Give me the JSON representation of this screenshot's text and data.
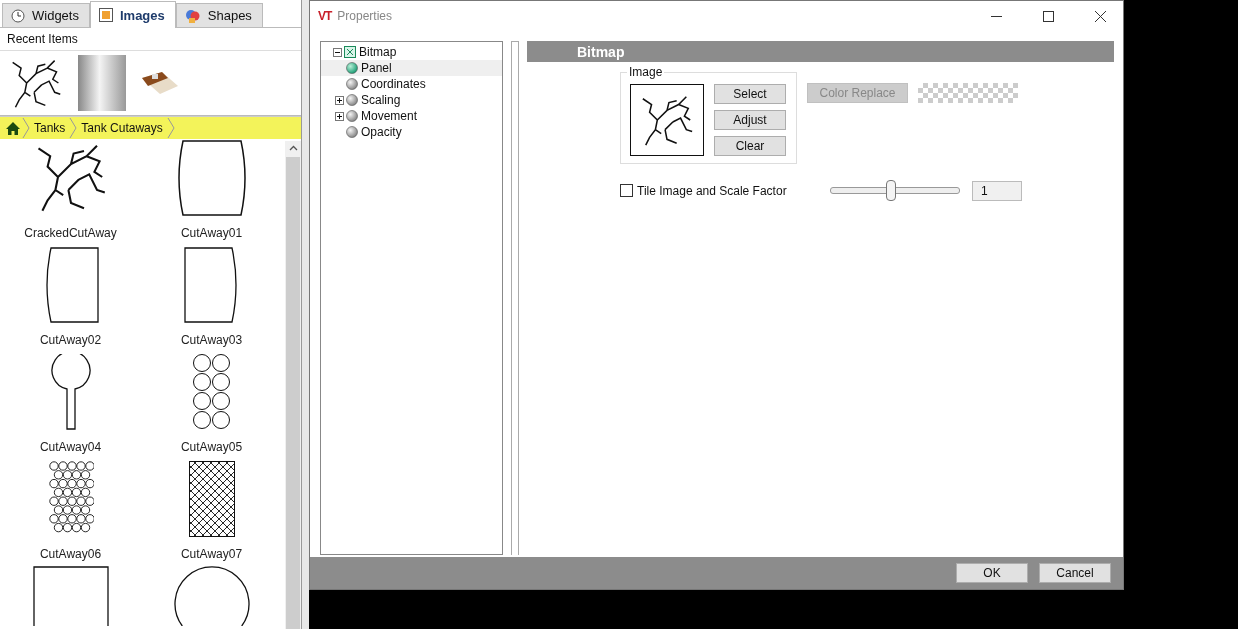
{
  "library": {
    "tabs": [
      {
        "label": "Widgets",
        "selected": false
      },
      {
        "label": "Images",
        "selected": true
      },
      {
        "label": "Shapes",
        "selected": false
      }
    ],
    "recent_title": "Recent Items",
    "recent_items": [
      {
        "kind": "crack"
      },
      {
        "kind": "cylinder"
      },
      {
        "kind": "device"
      }
    ],
    "breadcrumb": [
      "Tanks",
      "Tank Cutaways"
    ],
    "items": [
      {
        "label": "CrackedCutAway",
        "kind": "crack"
      },
      {
        "label": "CutAway01",
        "kind": "barrel"
      },
      {
        "label": "CutAway02",
        "kind": "left-rounded"
      },
      {
        "label": "CutAway03",
        "kind": "right-rounded"
      },
      {
        "label": "CutAway04",
        "kind": "lollipop"
      },
      {
        "label": "CutAway05",
        "kind": "circle-grid"
      },
      {
        "label": "CutAway06",
        "kind": "circle-cluster"
      },
      {
        "label": "CutAway07",
        "kind": "crosshatch"
      },
      {
        "kind": "square"
      },
      {
        "kind": "circle"
      }
    ]
  },
  "dialog": {
    "logo": "VT",
    "title": "Properties",
    "tree": {
      "label": "Bitmap",
      "expanded": true,
      "children": [
        {
          "label": "Panel",
          "selected": true
        },
        {
          "label": "Coordinates",
          "selected": false
        },
        {
          "label": "Scaling",
          "selected": false,
          "expanded": false
        },
        {
          "label": "Movement",
          "selected": false,
          "expanded": false
        },
        {
          "label": "Opacity",
          "selected": false
        }
      ]
    },
    "section_title": "Bitmap",
    "image_group": "Image",
    "image_buttons": [
      "Select",
      "Adjust",
      "Clear"
    ],
    "color_replace": {
      "label": "Color Replace",
      "disabled": true
    },
    "tile": {
      "label": "Tile Image and Scale Factor",
      "checked": false
    },
    "scale": {
      "level": 0.46,
      "value": "1"
    },
    "buttons": [
      "OK",
      "Cancel"
    ]
  }
}
